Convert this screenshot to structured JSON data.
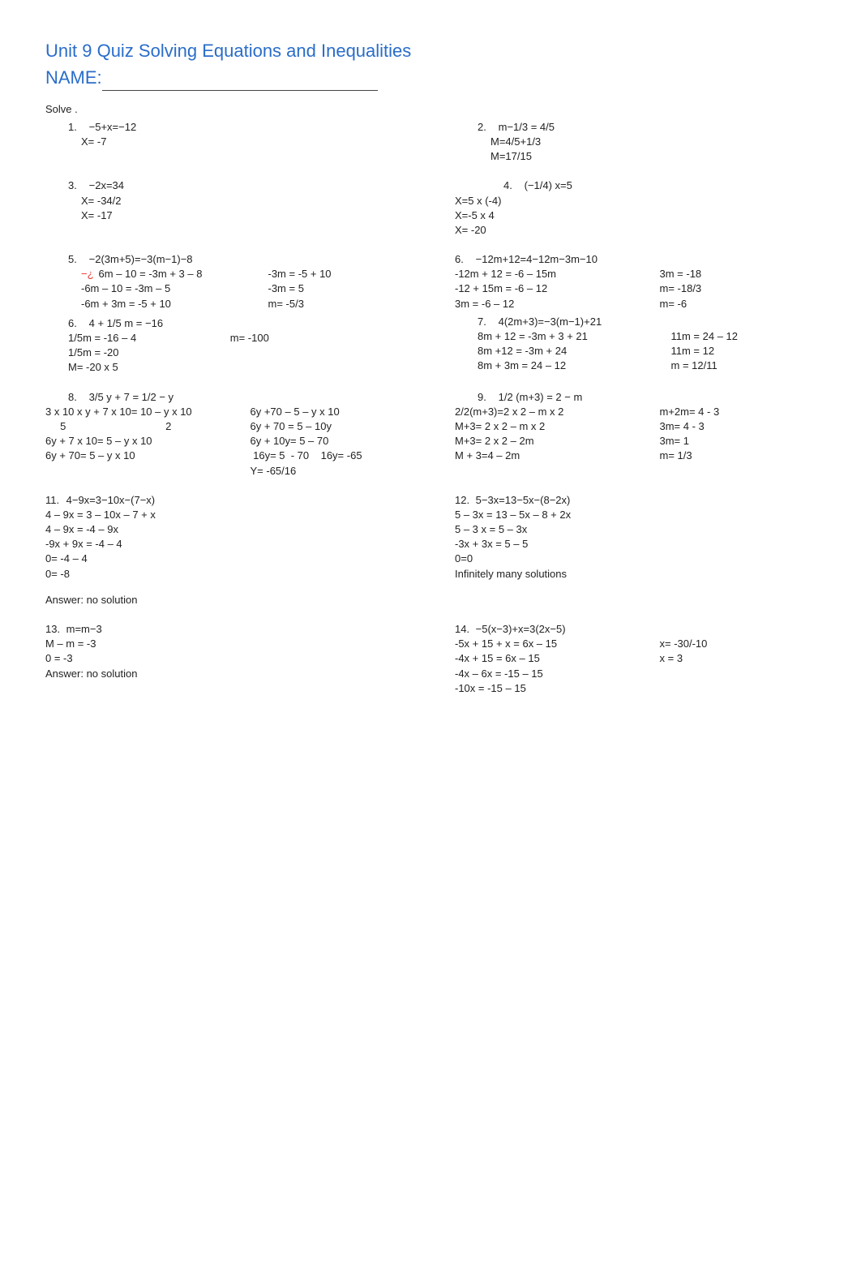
{
  "title": "Unit 9 Quiz Solving Equations and Inequalities",
  "name_label": "NAME:",
  "solve_label": "Solve .",
  "problems": {
    "p1": {
      "num": "1.",
      "eq": "−5+x=−12",
      "steps": [
        "X= -7"
      ]
    },
    "p2": {
      "num": "2.",
      "eq": "m−1/3 = 4/5",
      "steps": [
        "M=4/5+1/3",
        "M=17/15"
      ]
    },
    "p3": {
      "num": "3.",
      "eq": "−2x=34",
      "steps": [
        "X= -34/2",
        "X= -17"
      ]
    },
    "p4": {
      "num": "4.",
      "eq": "(−1/4) x=5",
      "steps": [
        "X=5 x (-4)",
        "X=-5 x 4",
        "X= -20"
      ]
    },
    "p5": {
      "num": "5.",
      "eq": "−2(3m+5)=−3(m−1)−8",
      "left": [
        "−¿   6m – 10 = -3m + 3 – 8",
        "-6m – 10 = -3m – 5",
        "-6m + 3m = -5 + 10"
      ],
      "right": [
        "-3m = -5 + 10",
        "-3m = 5",
        "m= -5/3"
      ]
    },
    "p6a": {
      "num": "6.",
      "eq": "−12m+12=4−12m−3m−10",
      "left": [
        "-12m + 12 = -6 – 15m",
        "-12 + 15m = -6 – 12",
        "3m = -6 – 12"
      ],
      "right": [
        "3m = -18",
        "m= -18/3",
        "m= -6"
      ]
    },
    "p7": {
      "num": "7.",
      "eq": "4(2m+3)=−3(m−1)+21",
      "left": [
        "8m + 12 = -3m + 3 + 21",
        "8m +12 = -3m + 24",
        "8m + 3m = 24 – 12"
      ],
      "right": [
        "11m = 24 – 12",
        "11m = 12",
        "m = 12/11"
      ]
    },
    "p6b": {
      "num": "6.",
      "eq": "4 + 1/5 m = −16",
      "steps": [
        "1/5m = -16 – 4                                m= -100",
        "1/5m = -20",
        "M= -20 x 5"
      ]
    },
    "p8": {
      "num": "8.",
      "eq": "3/5 y + 7 = 1/2 − y",
      "left": [
        "3 x 10 x y + 7 x 10= 10 – y x 10",
        "     5                                  2",
        "6y + 7 x 10= 5 – y x 10",
        "6y + 70= 5 – y x 10"
      ],
      "right": [
        "6y +70 – 5 – y x 10",
        "6y + 70 = 5 – 10y",
        "6y + 10y= 5 – 70",
        " 16y= 5  - 70    16y= -65",
        "Y= -65/16"
      ]
    },
    "p9": {
      "num": "9.",
      "eq": "1/2 (m+3) = 2 − m",
      "left": [
        "2/2(m+3)=2 x 2 – m x 2",
        "M+3= 2 x 2 – m x 2",
        "M+3= 2 x 2 – 2m",
        "M + 3=4 – 2m"
      ],
      "right": [
        "m+2m= 4 - 3",
        "3m= 4 - 3",
        "3m= 1",
        "m= 1/3"
      ]
    },
    "p11": {
      "num": "11.",
      "eq": "4−9x=3−10x−(7−x)",
      "steps": [
        "4 – 9x = 3 – 10x – 7 + x",
        "4 – 9x = -4 – 9x",
        "-9x + 9x = -4 – 4",
        "0= -4 – 4",
        "0= -8",
        "",
        "Answer: no solution"
      ]
    },
    "p12": {
      "num": "12.",
      "eq": "5−3x=13−5x−(8−2x)",
      "steps": [
        "5 – 3x = 13 – 5x – 8 + 2x",
        "5 – 3 x = 5 – 3x",
        "-3x + 3x = 5 – 5",
        "0=0",
        "Infinitely many solutions"
      ]
    },
    "p13": {
      "num": "13.",
      "eq": "m=m−3",
      "steps": [
        "M – m = -3",
        "0 = -3",
        "Answer: no solution"
      ]
    },
    "p14": {
      "num": "14.",
      "eq": "−5(x−3)+x=3(2x−5)",
      "left": [
        "-5x + 15 + x = 6x – 15",
        "-4x + 15 = 6x – 15",
        "-4x – 6x = -15 – 15",
        "-10x = -15 – 15"
      ],
      "right": [
        "x= -30/-10",
        "x = 3"
      ]
    }
  }
}
